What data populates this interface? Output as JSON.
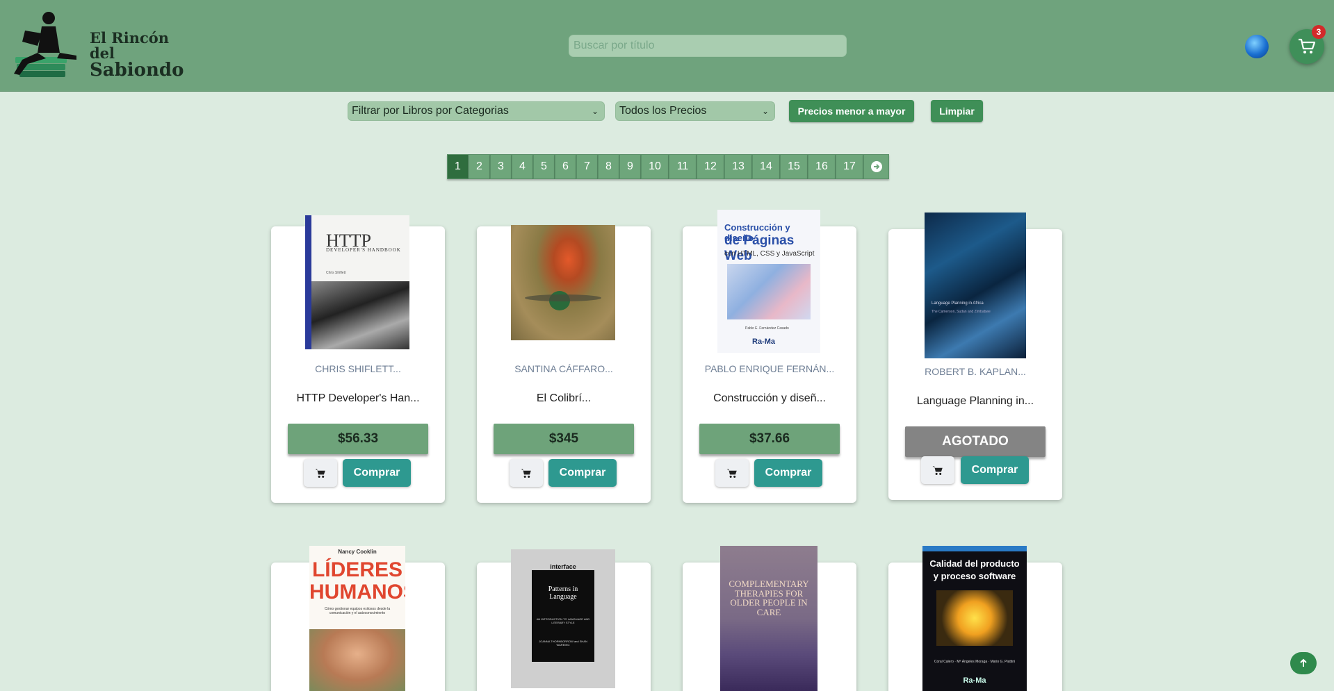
{
  "header": {
    "brand_line1": "El Rincón del",
    "brand_line2": "Sabiondo",
    "search_placeholder": "Buscar por título",
    "cart_count": "3"
  },
  "filters": {
    "category_select": "Filtrar por Libros por Categorias",
    "price_select": "Todos los Precios",
    "sort_button": "Precios menor a mayor",
    "clear_button": "Limpiar"
  },
  "pagination": {
    "pages": [
      "1",
      "2",
      "3",
      "4",
      "5",
      "6",
      "7",
      "8",
      "9",
      "10",
      "11",
      "12",
      "13",
      "14",
      "15",
      "16",
      "17"
    ],
    "active": "1"
  },
  "books": [
    {
      "author": "CHRIS SHIFLETT...",
      "title": "HTTP Developer's Han...",
      "price": "$56.33",
      "buy": "Comprar",
      "cover_title": "HTTP",
      "cover_subtitle": "DEVELOPER'S HANDBOOK",
      "cover_author": "Chris Shiflett"
    },
    {
      "author": "SANTINA CÁFFARO...",
      "title": "El Colibrí...",
      "price": "$345",
      "buy": "Comprar"
    },
    {
      "author": "PABLO ENRIQUE FERNÁN...",
      "title": "Construcción y diseñ...",
      "price": "$37.66",
      "buy": "Comprar",
      "cover_line1": "Construcción y diseño",
      "cover_line2": "de Páginas Web",
      "cover_line3": "con HTML, CSS y JavaScript",
      "cover_author": "Pablo E. Fernández Casado",
      "cover_publisher": "Ra-Ma"
    },
    {
      "author": "ROBERT B. KAPLAN...",
      "title": "Language Planning in...",
      "price": "AGOTADO",
      "buy": "Comprar",
      "cover_title": "Language Planning in Africa",
      "cover_subtitle": "The Cameroon, Sudan and Zimbabwe"
    },
    {
      "cover_author": "Nancy Cooklin",
      "cover_line1": "LÍDERES",
      "cover_line2": "HUMANOS",
      "cover_line3": "Cómo gestionar equipos exitosos desde la comunicación y el autoconocimiento"
    },
    {
      "cover_series": "interface",
      "cover_title": "Patterns in Language",
      "cover_subtitle": "AN INTRODUCTION TO LANGUAGE AND LITERARY STYLE",
      "cover_author": "JOANNA THORNBORROW and SHAN WAREING"
    },
    {
      "cover_title": "COMPLEMENTARY THERAPIES FOR OLDER PEOPLE IN CARE"
    },
    {
      "cover_line1": "Calidad del producto",
      "cover_line2": "y proceso software",
      "cover_author": "Coral Calero · Mª Ángeles Moraga · Mario G. Piattini",
      "cover_publisher": "Ra-Ma"
    }
  ],
  "colors": {
    "header_bg": "#6fa37d",
    "page_bg": "#dcebe0",
    "accent_green": "#3f8f57",
    "buy_teal": "#2e9990",
    "sold_out": "#848484",
    "badge_red": "#d32a2a"
  }
}
